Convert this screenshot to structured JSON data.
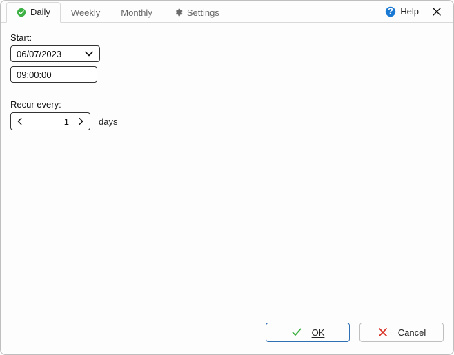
{
  "tabs": {
    "daily": "Daily",
    "weekly": "Weekly",
    "monthly": "Monthly",
    "settings": "Settings"
  },
  "header": {
    "help": "Help"
  },
  "form": {
    "start_label": "Start:",
    "start_date": "06/07/2023",
    "start_time": "09:00:00",
    "recur_label": "Recur every:",
    "recur_value": "1",
    "recur_unit": "days"
  },
  "footer": {
    "ok": "OK",
    "cancel": "Cancel"
  }
}
